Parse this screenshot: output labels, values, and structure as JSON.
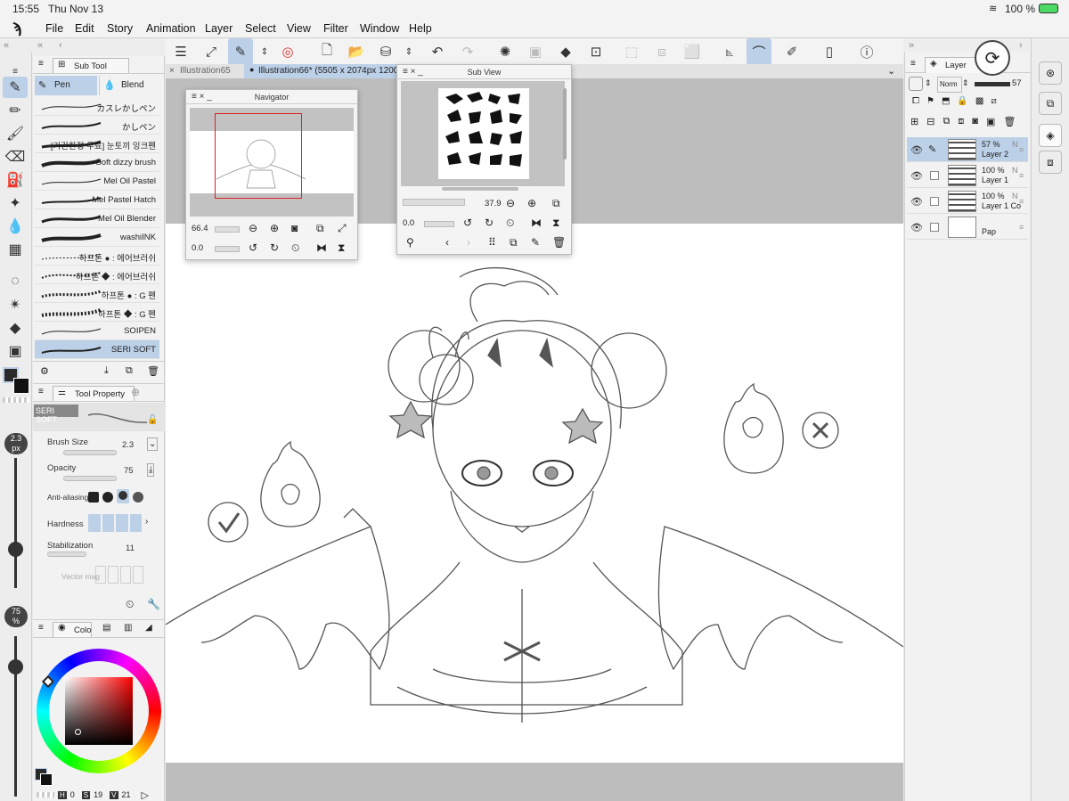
{
  "status": {
    "time": "15:55",
    "date": "Thu Nov 13",
    "battery": "100 %"
  },
  "menu": [
    "File",
    "Edit",
    "Story",
    "Animation",
    "Layer",
    "Select",
    "View",
    "Filter",
    "Window",
    "Help"
  ],
  "subtool": {
    "title": "Sub Tool",
    "tabs": [
      "Pen",
      "Blend"
    ],
    "brushes": [
      "カスレかしペン",
      "かしペン",
      "[기간한정 무료] 눈토끼 잉크펜",
      "Soft dizzy brush",
      "Mel Oil Pastel",
      "Mel Pastel Hatch",
      "Mel Oil Blender",
      "washiINK",
      "하프톤 ● : 에어브러쉬",
      "하프톤 ◆ : 에어브러쉬",
      "하프톤 ● : G 펜",
      "하프톤 ◆ : G 펜",
      "SOIPEN",
      "SERI SOFT"
    ]
  },
  "toolprop": {
    "title": "Tool Property",
    "preset": "SERI SOFT",
    "brush_size_label": "Brush Size",
    "brush_size": "2.3",
    "opacity_label": "Opacity",
    "opacity": "75",
    "aa_label": "Anti-aliasing",
    "hardness_label": "Hardness",
    "stabilization_label": "Stabilization",
    "stabilization": "11",
    "vector_label": "Vector mag"
  },
  "leftsliders": {
    "size": "2.3",
    "size_unit": "px",
    "opacity": "75",
    "opacity_unit": "%"
  },
  "color": {
    "title": "Colo",
    "h_label": "H",
    "h": "0",
    "s_label": "S",
    "s": "19",
    "v_label": "V",
    "v": "21",
    "accent": "#bcd0e8"
  },
  "doctabs": {
    "tab1": "Illustration65",
    "tab2": "Illustration66* (5505 x 2074px 1200"
  },
  "navigator": {
    "title": "Navigator",
    "zoom": "66.4",
    "angle": "0.0"
  },
  "subview": {
    "title": "Sub View",
    "zoom": "37.9",
    "angle": "0.0"
  },
  "layers": {
    "title": "Layer",
    "blend": "Norm",
    "opacity": "57",
    "items": [
      {
        "pct": "57 %",
        "mode": "N",
        "name": "Layer 2"
      },
      {
        "pct": "100 %",
        "mode": "N",
        "name": "Layer 1"
      },
      {
        "pct": "100 %",
        "mode": "N",
        "name": "Layer 1 Co"
      },
      {
        "pct": "",
        "mode": "",
        "name": "Pap"
      }
    ]
  }
}
